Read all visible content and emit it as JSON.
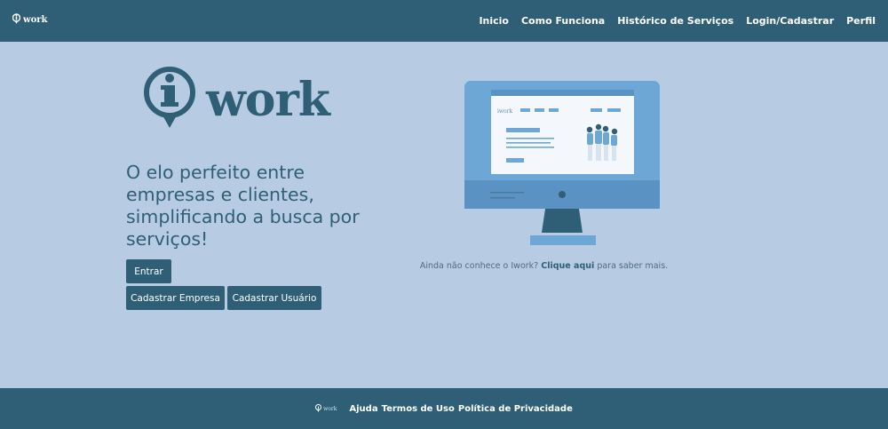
{
  "colors": {
    "primary": "#2f5f76",
    "background": "#b7cbe3",
    "screen_blue": "#6ca7d6",
    "white": "#ffffff"
  },
  "navbar": {
    "brand_word": "work",
    "links": [
      "Inicio",
      "Como Funciona",
      "Histórico de Serviços",
      "Login/Cadastrar",
      "Perfil"
    ]
  },
  "hero": {
    "logo_word": "work",
    "tagline": "O elo perfeito entre empresas e clientes, simplificando a busca por serviços!",
    "buttons": {
      "entrar": "Entrar",
      "cadastrar_empresa": "Cadastrar Empresa",
      "cadastrar_usuario": "Cadastrar Usuário"
    }
  },
  "info": {
    "prefix": "Ainda não conhece o Iwork?",
    "link": "Clique aqui",
    "suffix": "para saber mais."
  },
  "footer": {
    "logo_word": "work",
    "links": [
      "Ajuda",
      "Termos de Uso",
      "Política de Privacidade"
    ]
  },
  "icons": {
    "brand": "iwork-logo-icon",
    "illustration": "computer-monitor-illustration"
  }
}
